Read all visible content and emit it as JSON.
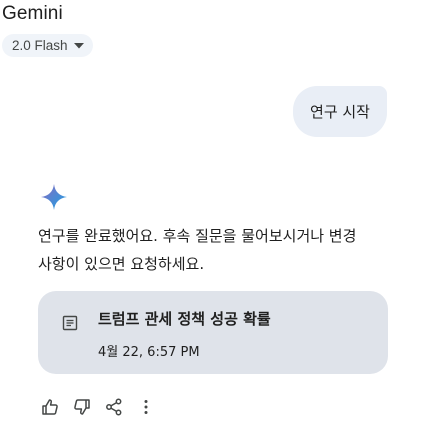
{
  "header": {
    "app_title": "Gemini",
    "model_label": "2.0 Flash",
    "model_dropdown_icon": "caret-down-icon"
  },
  "conversation": {
    "user_message": "연구 시작",
    "assistant": {
      "avatar_icon": "gemini-sparkle-icon",
      "text_line_1": "연구를 완료했어요. 후속 질문을 물어보시거나 변경",
      "text_line_2": "사항이 있으면 요청하세요.",
      "document": {
        "icon": "document-icon",
        "title": "트럼프 관세 정책 성공 확률",
        "date": "4월 22, 6:57 PM"
      },
      "actions": [
        "thumbs-up-icon",
        "thumbs-down-icon",
        "share-icon",
        "more-vert-icon"
      ]
    }
  },
  "colors": {
    "accent": "#4285f4",
    "chip_bg": "#f0f4f9",
    "user_bubble_bg": "#e9eef6",
    "doc_card_bg": "#dfe3ea",
    "icon_color": "#444746"
  }
}
